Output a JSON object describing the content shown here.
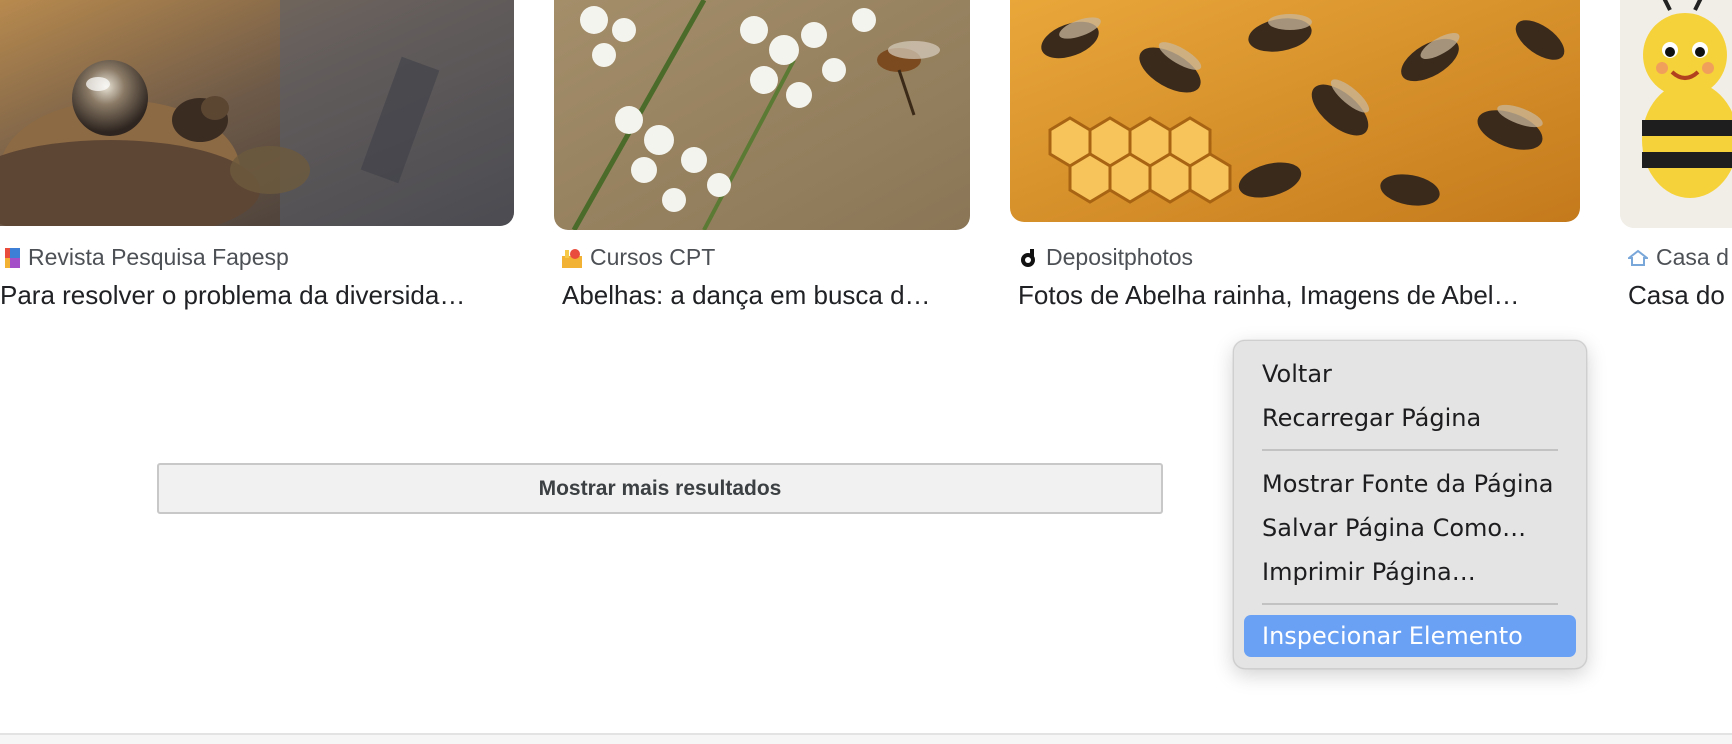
{
  "results": [
    {
      "source": "Revista Pesquisa Fapesp",
      "title": "Para resolver o problema da diversida…",
      "favicon_icon": "fapesp-logo-icon"
    },
    {
      "source": "Cursos CPT",
      "title": "Abelhas: a dança em busca d…",
      "favicon_icon": "cpt-logo-icon"
    },
    {
      "source": "Depositphotos",
      "title": "Fotos de Abelha rainha, Imagens de Abel…",
      "favicon_icon": "depositphotos-logo-icon"
    },
    {
      "source": "Casa d",
      "title": "Casa do",
      "favicon_icon": "casa-logo-icon"
    }
  ],
  "more_results_label": "Mostrar mais resultados",
  "context_menu": {
    "items": [
      {
        "label": "Voltar"
      },
      {
        "label": "Recarregar Página"
      },
      {
        "label": "Mostrar Fonte da Página"
      },
      {
        "label": "Salvar Página Como…"
      },
      {
        "label": "Imprimir Página…"
      },
      {
        "label": "Inspecionar Elemento"
      }
    ],
    "highlighted_item": "Inspecionar Elemento"
  },
  "colors": {
    "menu_highlight": "#6aa1f5",
    "menu_background": "#e4e4e4",
    "title_text": "#202124",
    "source_text": "#4d5156"
  }
}
